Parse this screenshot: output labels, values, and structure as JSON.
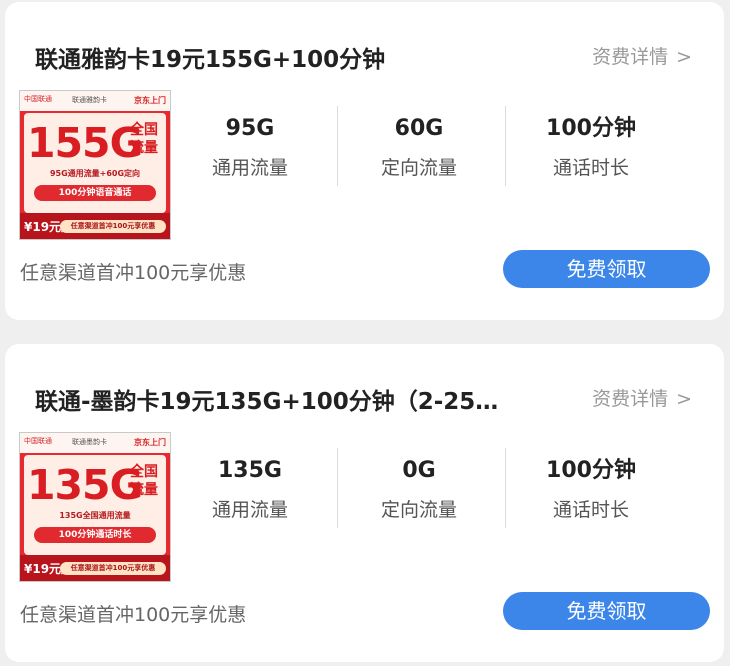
{
  "cards": [
    {
      "title": "联通雅韵卡19元155G+100分钟",
      "detail_link": "资费详情",
      "detail_chevron": ">",
      "thumbnail": {
        "brand": "中国联通",
        "name": "联通雅韵卡",
        "badge": "京东上门",
        "headline": "155G",
        "headline_side": "全国 流量",
        "line1": "95G通用流量+60G定向",
        "pill": "100分钟语音通话",
        "price": "¥19元/月",
        "ribbon": "任意渠道首冲100元享优惠"
      },
      "stats": [
        {
          "value": "95G",
          "label": "通用流量"
        },
        {
          "value": "60G",
          "label": "定向流量"
        },
        {
          "value": "100分钟",
          "label": "通话时长"
        }
      ],
      "promo": "任意渠道首冲100元享优惠",
      "button": "免费领取"
    },
    {
      "title": "联通-墨韵卡19元135G+100分钟（2-25…",
      "detail_link": "资费详情",
      "detail_chevron": ">",
      "thumbnail": {
        "brand": "中国联通",
        "name": "联通墨韵卡",
        "badge": "京东上门",
        "headline": "135G",
        "headline_side": "全国 流量",
        "line1": "135G全国通用流量",
        "pill": "100分钟通话时长",
        "price": "¥19元/月",
        "ribbon": "任意渠道首冲100元享优惠"
      },
      "stats": [
        {
          "value": "135G",
          "label": "通用流量"
        },
        {
          "value": "0G",
          "label": "定向流量"
        },
        {
          "value": "100分钟",
          "label": "通话时长"
        }
      ],
      "promo": "任意渠道首冲100元享优惠",
      "button": "免费领取"
    }
  ],
  "colors": {
    "accent_button": "#3b86e8",
    "card_background": "#ffffff",
    "page_background": "#efefef",
    "thumbnail_red": "#e72a2f"
  }
}
